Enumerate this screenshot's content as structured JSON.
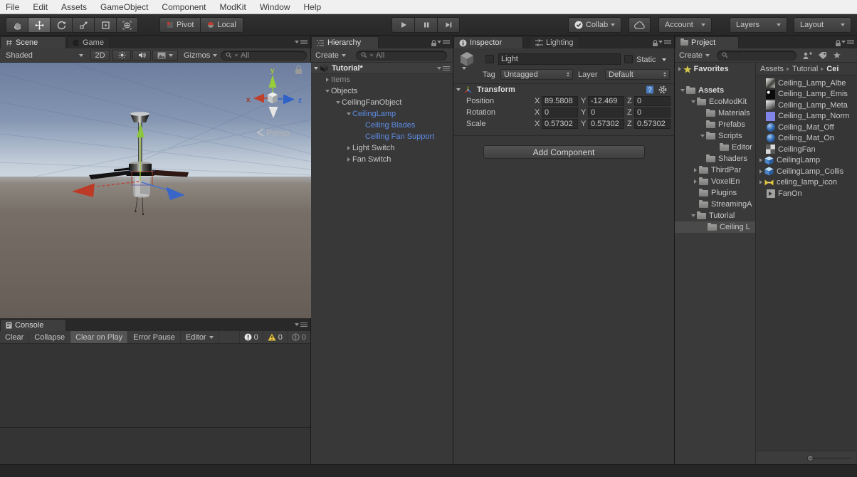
{
  "menu_bar": {
    "items": [
      "File",
      "Edit",
      "Assets",
      "GameObject",
      "Component",
      "ModKit",
      "Window",
      "Help"
    ]
  },
  "toolbar": {
    "pivot_label": "Pivot",
    "local_label": "Local",
    "collab_label": "Collab",
    "account_label": "Account",
    "layers_label": "Layers",
    "layout_label": "Layout"
  },
  "scene": {
    "tab_label": "Scene",
    "game_tab_label": "Game",
    "shading_mode": "Shaded",
    "mode_2d_label": "2D",
    "gizmos_label": "Gizmos",
    "search_value": "All",
    "persp_label": "Persp",
    "axis_x": "x",
    "axis_y": "y",
    "axis_z": "z"
  },
  "console": {
    "tab_label": "Console",
    "clear_label": "Clear",
    "collapse_label": "Collapse",
    "clear_on_play_label": "Clear on Play",
    "error_pause_label": "Error Pause",
    "editor_label": "Editor",
    "error_count": "0",
    "warning_count": "0",
    "info_count": "0"
  },
  "hierarchy": {
    "tab_label": "Hierarchy",
    "create_label": "Create",
    "search_value": "All",
    "scene_name": "Tutorial*",
    "items": [
      {
        "label": "Items"
      },
      {
        "label": "Objects"
      },
      {
        "label": "CeilingFanObject"
      },
      {
        "label": "CeilingLamp"
      },
      {
        "label": "Ceiling Blades"
      },
      {
        "label": "Ceiling Fan Support"
      },
      {
        "label": "Light Switch"
      },
      {
        "label": "Fan Switch"
      }
    ]
  },
  "inspector": {
    "tab_label": "Inspector",
    "lighting_tab_label": "Lighting",
    "object_name": "Light",
    "static_label": "Static",
    "tag_label": "Tag",
    "tag_value": "Untagged",
    "layer_label": "Layer",
    "layer_value": "Default",
    "transform": {
      "title": "Transform",
      "x": "X",
      "y": "Y",
      "z": "Z",
      "rows": [
        {
          "label": "Position",
          "x": "89.5808",
          "y": "-12.469",
          "z": "0"
        },
        {
          "label": "Rotation",
          "x": "0",
          "y": "0",
          "z": "0"
        },
        {
          "label": "Scale",
          "x": "0.57302",
          "y": "0.57302",
          "z": "0.57302"
        }
      ]
    },
    "add_component_label": "Add Component"
  },
  "project": {
    "tab_label": "Project",
    "create_label": "Create",
    "favorites_label": "Favorites",
    "tree": [
      {
        "label": "Assets"
      },
      {
        "label": "EcoModKit"
      },
      {
        "label": "Materials"
      },
      {
        "label": "Prefabs"
      },
      {
        "label": "Scripts"
      },
      {
        "label": "Editor"
      },
      {
        "label": "Shaders"
      },
      {
        "label": "ThirdPar"
      },
      {
        "label": "VoxelEn"
      },
      {
        "label": "Plugins"
      },
      {
        "label": "StreamingA"
      },
      {
        "label": "Tutorial"
      },
      {
        "label": "Ceiling L"
      }
    ],
    "breadcrumb": [
      {
        "label": "Assets"
      },
      {
        "label": "Tutorial"
      },
      {
        "label": "Cei"
      }
    ],
    "assets": [
      {
        "label": "Ceiling_Lamp_Albe"
      },
      {
        "label": "Ceiling_Lamp_Emis"
      },
      {
        "label": "Ceiling_Lamp_Meta"
      },
      {
        "label": "Ceiling_Lamp_Norm"
      },
      {
        "label": "Ceiling_Mat_Off"
      },
      {
        "label": "Ceiling_Mat_On"
      },
      {
        "label": "CeilingFan"
      },
      {
        "label": "CeilingLamp"
      },
      {
        "label": "CeilingLamp_Collis"
      },
      {
        "label": "celing_lamp_icon"
      },
      {
        "label": "FanOn"
      }
    ]
  },
  "colors": {
    "prefab_blue": "#5C8CE4",
    "selection_gray": "#4A4A4A",
    "warning_yellow": "#E5C341"
  }
}
